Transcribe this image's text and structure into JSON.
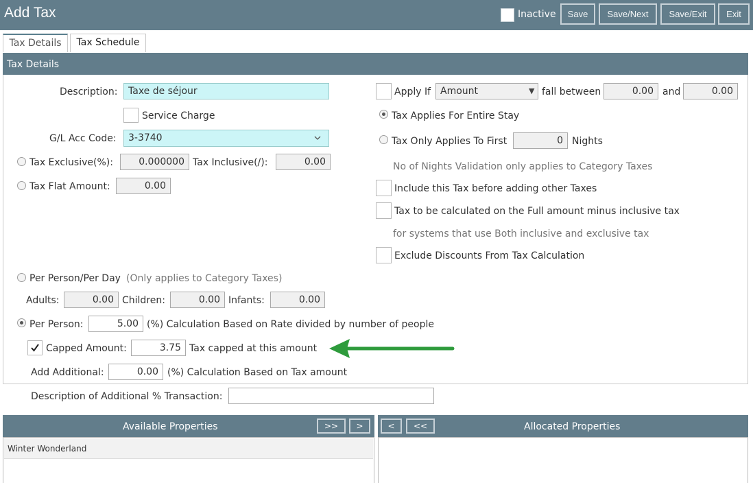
{
  "header": {
    "title": "Add Tax",
    "inactive_label": "Inactive",
    "buttons": {
      "save": "Save",
      "save_next": "Save/Next",
      "save_exit": "Save/Exit",
      "exit": "Exit"
    }
  },
  "tabs": [
    "Tax Details",
    "Tax Schedule"
  ],
  "panel_title": "Tax Details",
  "left": {
    "description_label": "Description:",
    "description_value": "Taxe de séjour",
    "service_charge_label": "Service Charge",
    "gl_label": "G/L Acc Code:",
    "gl_value": "3-3740",
    "tax_exclusive_label": "Tax Exclusive(%):",
    "tax_exclusive_value": "0.000000",
    "tax_inclusive_label": "Tax Inclusive(/):",
    "tax_inclusive_value": "0.00",
    "tax_flat_label": "Tax Flat Amount:",
    "tax_flat_value": "0.00",
    "per_person_day_label": "Per Person/Per Day",
    "per_person_day_note": "(Only applies to Category Taxes)",
    "adults_label": "Adults:",
    "adults_value": "0.00",
    "children_label": "Children:",
    "children_value": "0.00",
    "infants_label": "Infants:",
    "infants_value": "0.00",
    "per_person_label": "Per Person:",
    "per_person_value": "5.00",
    "per_person_note": "(%) Calculation Based on Rate divided by number of people",
    "capped_label": "Capped Amount:",
    "capped_value": "3.75",
    "capped_note": "Tax capped at this amount",
    "add_additional_label": "Add Additional:",
    "add_additional_value": "0.00",
    "add_additional_note": "(%) Calculation Based on Tax amount",
    "desc_additional_label": "Description of Additional % Transaction:",
    "desc_additional_value": ""
  },
  "right": {
    "apply_if_label": "Apply If",
    "apply_if_select": "Amount",
    "fall_between_label": "fall between",
    "fall_from": "0.00",
    "and_label": "and",
    "fall_to": "0.00",
    "entire_stay_label": "Tax Applies For Entire Stay",
    "first_nights_label": "Tax Only Applies To First",
    "first_nights_value": "0",
    "nights_label": "Nights",
    "nights_note": "No of Nights Validation only applies to Category Taxes",
    "include_before_label": "Include this Tax before adding other Taxes",
    "full_amount_label": "Tax to be calculated on the Full amount minus inclusive tax",
    "full_amount_note": "for systems that use Both inclusive and exclusive tax",
    "exclude_discounts_label": "Exclude Discounts From Tax Calculation"
  },
  "lists": {
    "available_title": "Available Properties",
    "allocated_title": "Allocated Properties",
    "move_all_right": ">>",
    "move_right": ">",
    "move_left": "<",
    "move_all_left": "<<",
    "available_items": [
      "Winter Wonderland"
    ]
  },
  "colors": {
    "header": "#627d8b",
    "annotation_arrow": "#2e9b3c",
    "description_bg": "#ccf5f7"
  }
}
